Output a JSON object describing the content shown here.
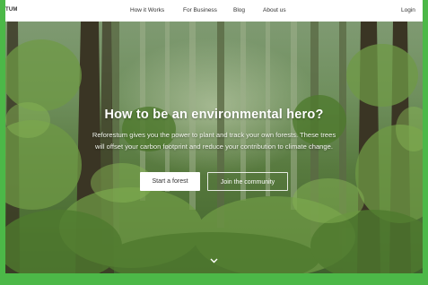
{
  "navbar": {
    "brand": "TUM",
    "links": [
      "How it Works",
      "For Business",
      "Blog",
      "About us"
    ],
    "login": "Login"
  },
  "hero": {
    "title": "How to be an environmental hero?",
    "subtitle": "Reforestum gives you the power to plant and track your own forests. These trees will offset your carbon footprint and reduce your contribution to climate change.",
    "primary_button": "Start a forest",
    "secondary_button": "Join the community",
    "scroll_icon": "chevron-down-icon"
  },
  "colors": {
    "frame_border": "#4cb848",
    "navbar_bg": "#ffffff",
    "primary_button_bg": "#ffffff"
  }
}
